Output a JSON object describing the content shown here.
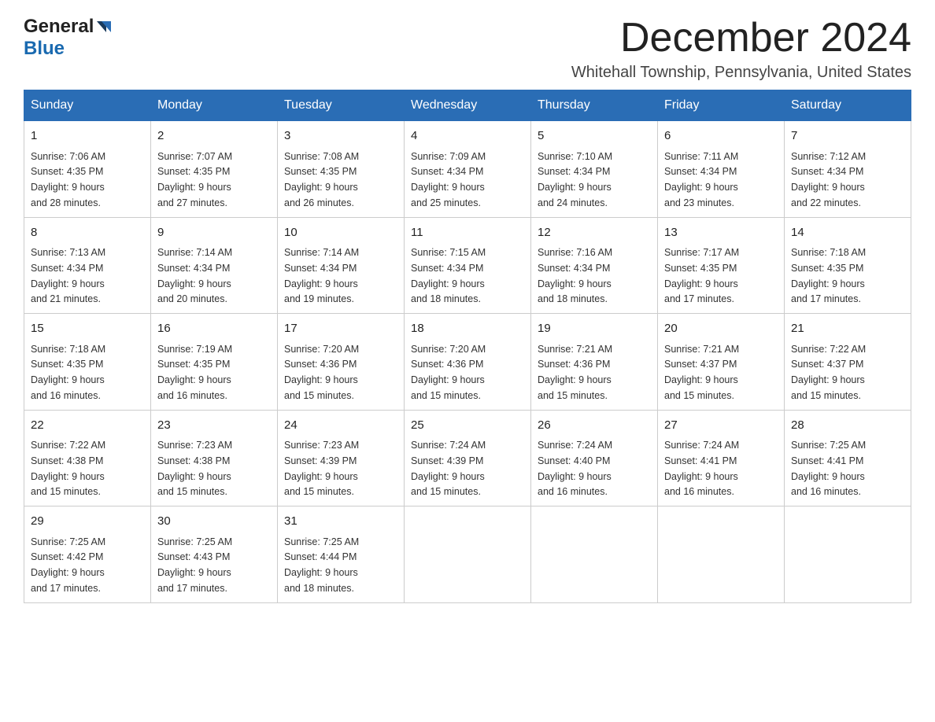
{
  "header": {
    "logo_general": "General",
    "logo_blue": "Blue",
    "month_title": "December 2024",
    "location": "Whitehall Township, Pennsylvania, United States"
  },
  "days_of_week": [
    "Sunday",
    "Monday",
    "Tuesday",
    "Wednesday",
    "Thursday",
    "Friday",
    "Saturday"
  ],
  "weeks": [
    [
      {
        "day": "1",
        "sunrise": "7:06 AM",
        "sunset": "4:35 PM",
        "daylight": "9 hours and 28 minutes."
      },
      {
        "day": "2",
        "sunrise": "7:07 AM",
        "sunset": "4:35 PM",
        "daylight": "9 hours and 27 minutes."
      },
      {
        "day": "3",
        "sunrise": "7:08 AM",
        "sunset": "4:35 PM",
        "daylight": "9 hours and 26 minutes."
      },
      {
        "day": "4",
        "sunrise": "7:09 AM",
        "sunset": "4:34 PM",
        "daylight": "9 hours and 25 minutes."
      },
      {
        "day": "5",
        "sunrise": "7:10 AM",
        "sunset": "4:34 PM",
        "daylight": "9 hours and 24 minutes."
      },
      {
        "day": "6",
        "sunrise": "7:11 AM",
        "sunset": "4:34 PM",
        "daylight": "9 hours and 23 minutes."
      },
      {
        "day": "7",
        "sunrise": "7:12 AM",
        "sunset": "4:34 PM",
        "daylight": "9 hours and 22 minutes."
      }
    ],
    [
      {
        "day": "8",
        "sunrise": "7:13 AM",
        "sunset": "4:34 PM",
        "daylight": "9 hours and 21 minutes."
      },
      {
        "day": "9",
        "sunrise": "7:14 AM",
        "sunset": "4:34 PM",
        "daylight": "9 hours and 20 minutes."
      },
      {
        "day": "10",
        "sunrise": "7:14 AM",
        "sunset": "4:34 PM",
        "daylight": "9 hours and 19 minutes."
      },
      {
        "day": "11",
        "sunrise": "7:15 AM",
        "sunset": "4:34 PM",
        "daylight": "9 hours and 18 minutes."
      },
      {
        "day": "12",
        "sunrise": "7:16 AM",
        "sunset": "4:34 PM",
        "daylight": "9 hours and 18 minutes."
      },
      {
        "day": "13",
        "sunrise": "7:17 AM",
        "sunset": "4:35 PM",
        "daylight": "9 hours and 17 minutes."
      },
      {
        "day": "14",
        "sunrise": "7:18 AM",
        "sunset": "4:35 PM",
        "daylight": "9 hours and 17 minutes."
      }
    ],
    [
      {
        "day": "15",
        "sunrise": "7:18 AM",
        "sunset": "4:35 PM",
        "daylight": "9 hours and 16 minutes."
      },
      {
        "day": "16",
        "sunrise": "7:19 AM",
        "sunset": "4:35 PM",
        "daylight": "9 hours and 16 minutes."
      },
      {
        "day": "17",
        "sunrise": "7:20 AM",
        "sunset": "4:36 PM",
        "daylight": "9 hours and 15 minutes."
      },
      {
        "day": "18",
        "sunrise": "7:20 AM",
        "sunset": "4:36 PM",
        "daylight": "9 hours and 15 minutes."
      },
      {
        "day": "19",
        "sunrise": "7:21 AM",
        "sunset": "4:36 PM",
        "daylight": "9 hours and 15 minutes."
      },
      {
        "day": "20",
        "sunrise": "7:21 AM",
        "sunset": "4:37 PM",
        "daylight": "9 hours and 15 minutes."
      },
      {
        "day": "21",
        "sunrise": "7:22 AM",
        "sunset": "4:37 PM",
        "daylight": "9 hours and 15 minutes."
      }
    ],
    [
      {
        "day": "22",
        "sunrise": "7:22 AM",
        "sunset": "4:38 PM",
        "daylight": "9 hours and 15 minutes."
      },
      {
        "day": "23",
        "sunrise": "7:23 AM",
        "sunset": "4:38 PM",
        "daylight": "9 hours and 15 minutes."
      },
      {
        "day": "24",
        "sunrise": "7:23 AM",
        "sunset": "4:39 PM",
        "daylight": "9 hours and 15 minutes."
      },
      {
        "day": "25",
        "sunrise": "7:24 AM",
        "sunset": "4:39 PM",
        "daylight": "9 hours and 15 minutes."
      },
      {
        "day": "26",
        "sunrise": "7:24 AM",
        "sunset": "4:40 PM",
        "daylight": "9 hours and 16 minutes."
      },
      {
        "day": "27",
        "sunrise": "7:24 AM",
        "sunset": "4:41 PM",
        "daylight": "9 hours and 16 minutes."
      },
      {
        "day": "28",
        "sunrise": "7:25 AM",
        "sunset": "4:41 PM",
        "daylight": "9 hours and 16 minutes."
      }
    ],
    [
      {
        "day": "29",
        "sunrise": "7:25 AM",
        "sunset": "4:42 PM",
        "daylight": "9 hours and 17 minutes."
      },
      {
        "day": "30",
        "sunrise": "7:25 AM",
        "sunset": "4:43 PM",
        "daylight": "9 hours and 17 minutes."
      },
      {
        "day": "31",
        "sunrise": "7:25 AM",
        "sunset": "4:44 PM",
        "daylight": "9 hours and 18 minutes."
      },
      null,
      null,
      null,
      null
    ]
  ],
  "labels": {
    "sunrise": "Sunrise:",
    "sunset": "Sunset:",
    "daylight": "Daylight:"
  }
}
